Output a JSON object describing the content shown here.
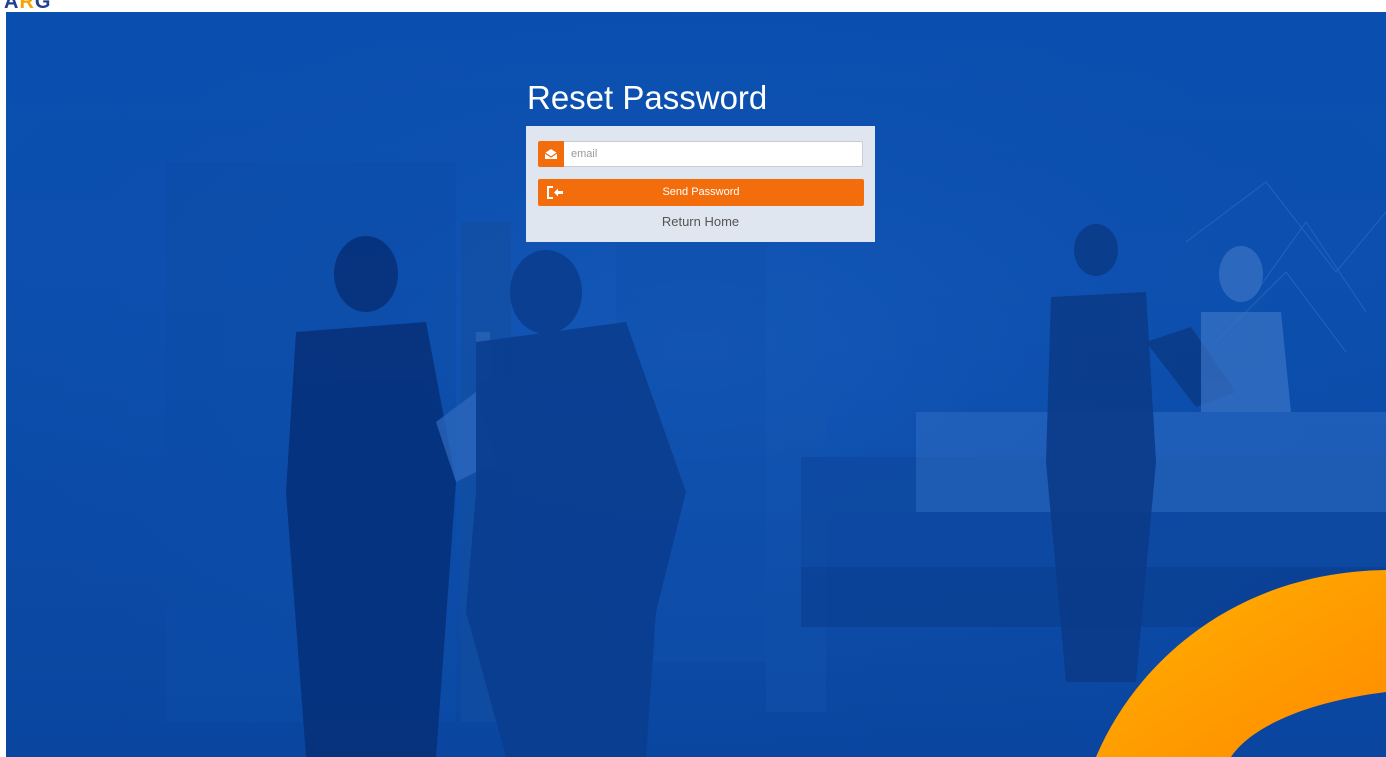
{
  "header": {
    "logo_text": "ARG"
  },
  "page": {
    "title": "Reset Password"
  },
  "form": {
    "email_placeholder": "email",
    "email_value": "",
    "send_button_label": "Send Password",
    "return_link_label": "Return Home"
  },
  "icons": {
    "email": "envelope-open-icon",
    "send": "sign-in-icon"
  },
  "colors": {
    "background_blue": "#0b4dab",
    "accent_orange": "#f36d0c",
    "swoosh_yellow": "#ffae00",
    "panel_bg": "#dfe6ef"
  }
}
